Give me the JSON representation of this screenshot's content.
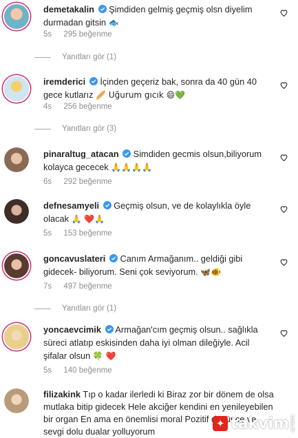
{
  "comments": [
    {
      "username": "demetakalin",
      "text": "Şimdiden gelmiş geçmiş olsn diyelim durmadan gitsin",
      "emoji": "🐟",
      "time": "5s",
      "likes": "295 beğenme",
      "replies": "Yanıtları gör (1)"
    },
    {
      "username": "iremderici",
      "text": "İçinden geçeriz bak, sonra da 40 gün 40 gece kutlarız",
      "emoji": "🥖 Uğurum gıcık 😄💚",
      "time": "4s",
      "likes": "256 beğenme",
      "replies": "Yanıtları gör (3)"
    },
    {
      "username": "pinaraltug_atacan",
      "text": "Simdiden gecmis olsun,biliyorum kolayca gececek",
      "emoji": "🙏🙏🙏🙏",
      "time": "6s",
      "likes": "292 beğenme"
    },
    {
      "username": "defnesamyeli",
      "text": "Geçmiş olsun, ve de kolaylıkla öyle olacak",
      "emoji": "🙏 ❤️🙏",
      "time": "5s",
      "likes": "153 beğenme"
    },
    {
      "username": "goncavuslateri",
      "text": "Canım Armağanım.. geldiği gibi gidecek- biliyorum. Seni çok seviyorum.",
      "emoji": "🦋🐠",
      "time": "7s",
      "likes": "497 beğenme",
      "replies": "Yanıtları gör (1)"
    },
    {
      "username": "yoncaevcimik",
      "text": "Armağan'cım geçmiş olsun.. sağlıkla süreci atlatıp eskisinden daha iyi olman dileğiyle. Acil şifalar olsun",
      "emoji": "🍀 ❤️",
      "time": "5s",
      "likes": "140 beğenme"
    },
    {
      "username": "filizakink",
      "text": "Tıp o kadar ilerledi ki Biraz zor bir dönem de olsa mutlaka bitip gidecek Hele akciğer kendini en yenileyebilen bir organ En ama en önemlisi moral Pozitif düşünce ve sevgi dolu dualar yolluyorum"
    }
  ],
  "watermark": "takvim",
  "watermark_suffix": "com.tr",
  "colors": {
    "verified": "#3897f0",
    "meta": "#8e8e8e",
    "brand": "#e3251b"
  }
}
